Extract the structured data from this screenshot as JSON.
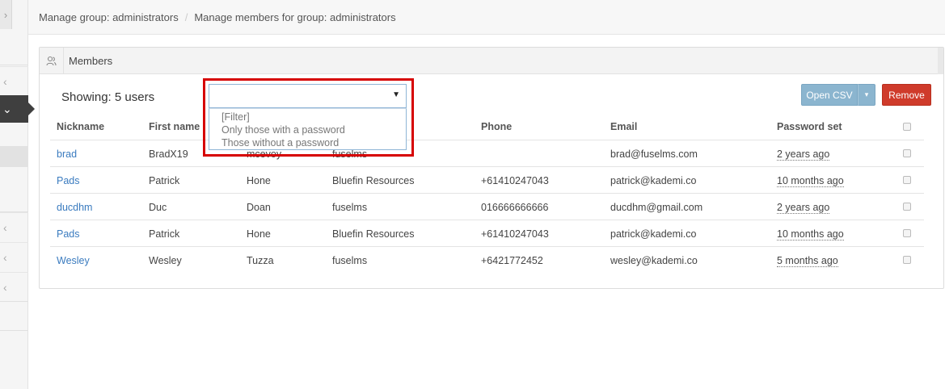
{
  "breadcrumb": {
    "item1": "Manage group: administrators",
    "separator": "/",
    "item2": "Manage members for group: administrators"
  },
  "panel": {
    "title": "Members"
  },
  "showing": "Showing: 5 users",
  "filter": {
    "options": [
      "[Filter]",
      "Only those with a password",
      "Those without a password"
    ]
  },
  "buttons": {
    "open_csv": "Open CSV",
    "remove": "Remove"
  },
  "table": {
    "headers": [
      "Nickname",
      "First name",
      "",
      "",
      "Phone",
      "Email",
      "Password set"
    ],
    "rows": [
      {
        "nickname": "brad",
        "first": "BradX19",
        "last": "mcevoy",
        "org": "fuselms",
        "phone": "",
        "email": "brad@fuselms.com",
        "pwset": "2 years ago"
      },
      {
        "nickname": "Pads",
        "first": "Patrick",
        "last": "Hone",
        "org": "Bluefin Resources",
        "phone": "+61410247043",
        "email": "patrick@kademi.co",
        "pwset": "10 months ago"
      },
      {
        "nickname": "ducdhm",
        "first": "Duc",
        "last": "Doan",
        "org": "fuselms",
        "phone": "016666666666",
        "email": "ducdhm@gmail.com",
        "pwset": "2 years ago"
      },
      {
        "nickname": "Pads",
        "first": "Patrick",
        "last": "Hone",
        "org": "Bluefin Resources",
        "phone": "+61410247043",
        "email": "patrick@kademi.co",
        "pwset": "10 months ago"
      },
      {
        "nickname": "Wesley",
        "first": "Wesley",
        "last": "Tuzza",
        "org": "fuselms",
        "phone": "+6421772452",
        "email": "wesley@kademi.co",
        "pwset": "5 months ago"
      }
    ]
  },
  "colors": {
    "link": "#3a7bbf",
    "remove": "#cf3b2b",
    "csv": "#8bb5cf",
    "highlight": "#d60000"
  }
}
